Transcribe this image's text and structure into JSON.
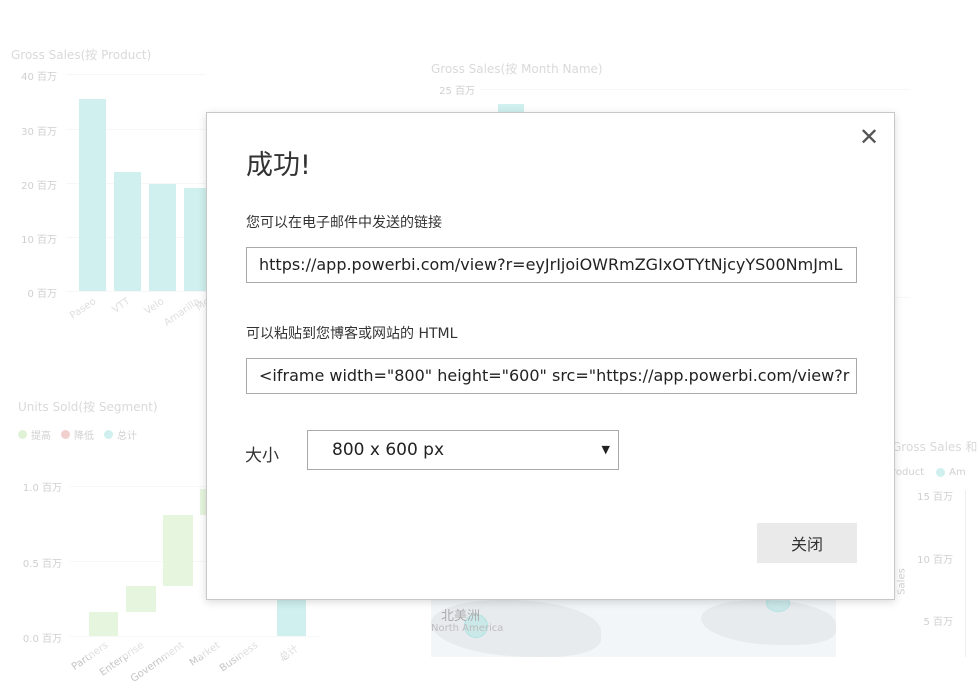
{
  "background": {
    "chart1": {
      "title": "Gross Sales(按 Product)",
      "ticks": [
        "40 百万",
        "30 百万",
        "20 百万",
        "10 百万",
        "0 百万"
      ],
      "categories": [
        "Paseo",
        "VTT",
        "Velo",
        "Amarilla",
        "Mo"
      ]
    },
    "chart2": {
      "title": "Gross Sales(按 Month Name)",
      "top_tick": "25 百万"
    },
    "chart3": {
      "title": "Units Sold(按 Segment)",
      "legend": [
        "提高",
        "降低",
        "总计"
      ],
      "ticks": [
        "1.0 百万",
        "0.5 百万",
        "0.0 百万"
      ],
      "categories": [
        "Partners",
        "Enterprise",
        "Government",
        "Market",
        "Business",
        "总计"
      ]
    },
    "chart4": {
      "title": "Gross Sales 和 S",
      "legend_items": [
        "roduct",
        "Am"
      ],
      "ticks": [
        "15 百万",
        "10 百万",
        "5 百万"
      ],
      "axis_label": "Sales"
    },
    "map": {
      "label": "北美洲",
      "sublabel": "North America"
    },
    "colors": {
      "teal": "#a8e4e0",
      "green": "#d2edc4",
      "red": "#e6a8a8"
    }
  },
  "dialog": {
    "title": "成功!",
    "close_icon": "close-icon",
    "link_label": "您可以在电子邮件中发送的链接",
    "link_value": "https://app.powerbi.com/view?r=eyJrIjoiOWRmZGIxOTYtNjcyYS00NmJmL",
    "embed_label": "可以粘贴到您博客或网站的 HTML",
    "embed_value": "<iframe width=\"800\" height=\"600\" src=\"https://app.powerbi.com/view?r",
    "size_label": "大小",
    "size_value": "800 x 600 px",
    "close_button": "关闭"
  }
}
